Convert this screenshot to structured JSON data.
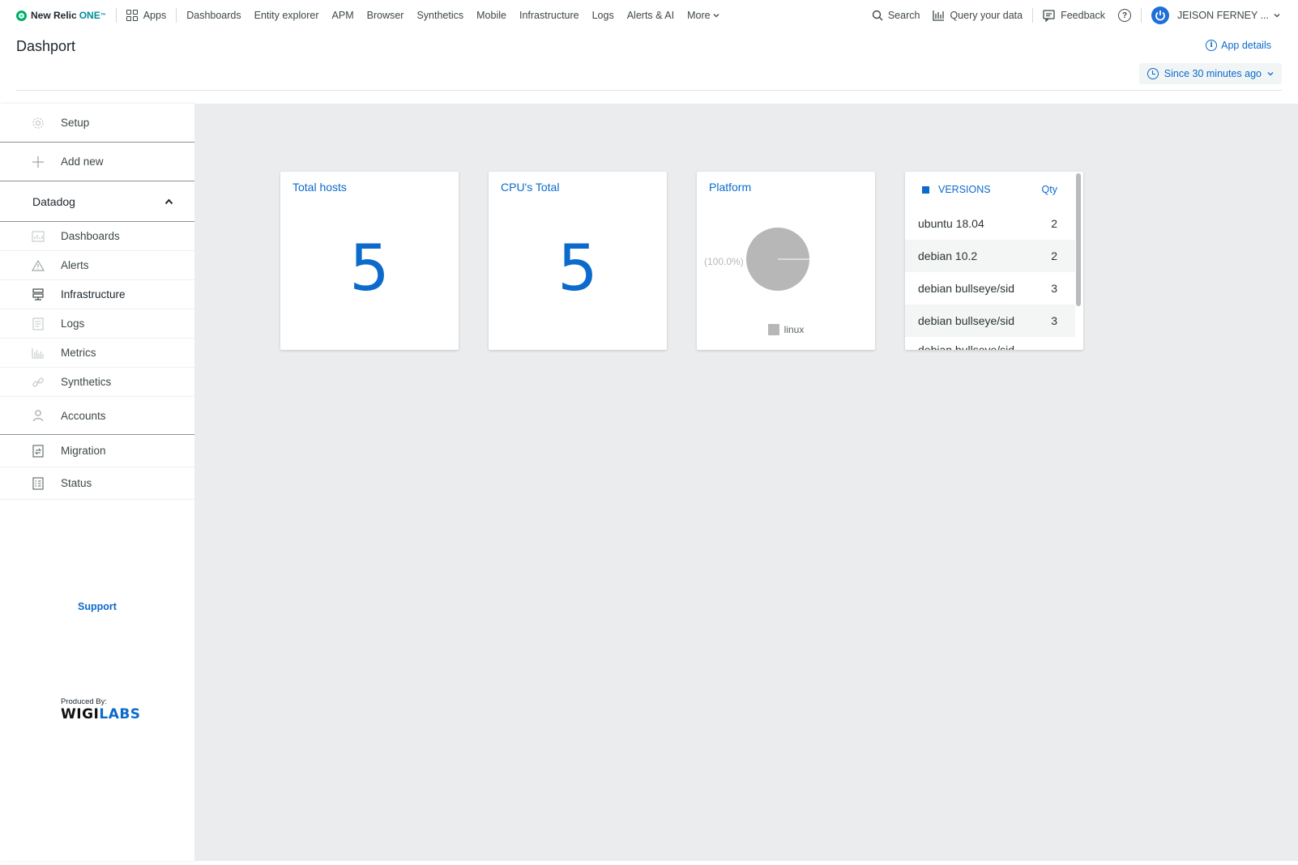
{
  "nav": {
    "brand_prefix": "New Relic",
    "brand_one": "ONE",
    "brand_tm": "™",
    "apps_label": "Apps",
    "links": [
      "Dashboards",
      "Entity explorer",
      "APM",
      "Browser",
      "Synthetics",
      "Mobile",
      "Infrastructure",
      "Logs",
      "Alerts & AI"
    ],
    "more_label": "More",
    "search_label": "Search",
    "query_label": "Query your data",
    "feedback_label": "Feedback",
    "user_name": "JEISON FERNEY ..."
  },
  "header": {
    "title": "Dashport",
    "app_details": "App details",
    "time_range": "Since 30 minutes ago"
  },
  "sidebar": {
    "setup": "Setup",
    "add_new": "Add new",
    "group": "Datadog",
    "items": [
      "Dashboards",
      "Alerts",
      "Infrastructure",
      "Logs",
      "Metrics",
      "Synthetics"
    ],
    "accounts": "Accounts",
    "bottom_items": [
      "Migration",
      "Status"
    ],
    "support": "Support",
    "produced_by": "Produced By:",
    "brand_a": "WIGI",
    "brand_b": "LABS"
  },
  "cards": {
    "total_hosts": {
      "title": "Total hosts",
      "value": "5"
    },
    "cpu_total": {
      "title": "CPU's Total",
      "value": "5"
    },
    "platform": {
      "title": "Platform",
      "pct_label": "(100.0%)",
      "legend": "linux"
    },
    "versions": {
      "col_name": "VERSIONS",
      "col_qty": "Qty",
      "rows": [
        {
          "name": "ubuntu 18.04",
          "qty": "2"
        },
        {
          "name": "debian 10.2",
          "qty": "2"
        },
        {
          "name": "debian bullseye/sid",
          "qty": "3"
        },
        {
          "name": "debian bullseye/sid",
          "qty": "3"
        },
        {
          "name": "debian bullseye/sid",
          "qty": ""
        }
      ]
    }
  },
  "chart_data": {
    "type": "pie",
    "title": "Platform",
    "categories": [
      "linux"
    ],
    "values": [
      100.0
    ],
    "colors": [
      "#b7b7b7"
    ]
  },
  "colors": {
    "accent": "#0b6acb",
    "canvas": "#ebeced",
    "pie": "#b7b7b7"
  }
}
